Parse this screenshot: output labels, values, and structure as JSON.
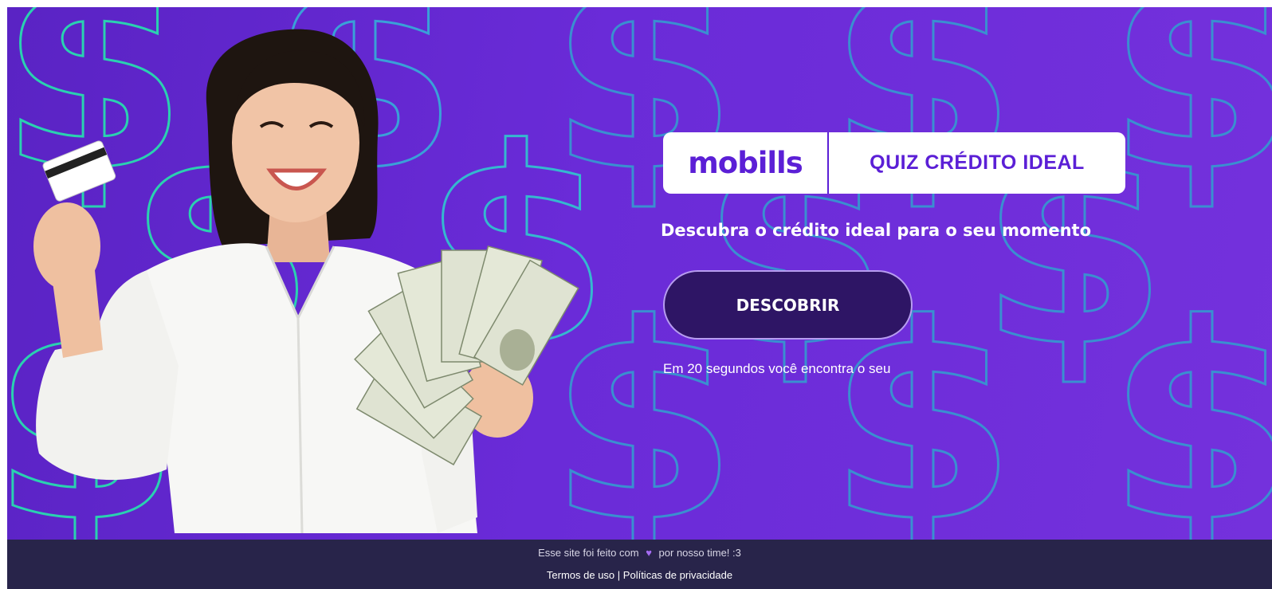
{
  "brand": {
    "logo_text": "mobills",
    "quiz_title": "QUIZ CRÉDITO IDEAL"
  },
  "hero": {
    "headline": "Descubra o crédito ideal para o seu momento",
    "cta_label": "DESCOBRIR",
    "subtext": "Em 20 segundos você encontra o seu",
    "background_symbol": "$"
  },
  "footer": {
    "made_with_prefix": "Esse site foi feito com",
    "heart_icon": "purple-heart-icon",
    "made_with_suffix": "por nosso time! :3",
    "terms_link": "Termos de uso",
    "separator": "|",
    "privacy_link": "Políticas de privacidade"
  },
  "colors": {
    "hero_bg": "#6a2bd8",
    "brand_purple": "#5b1fd6",
    "cta_bg": "#2e1565",
    "footer_bg": "#28244a",
    "teal_outline": "#27d1b5"
  }
}
